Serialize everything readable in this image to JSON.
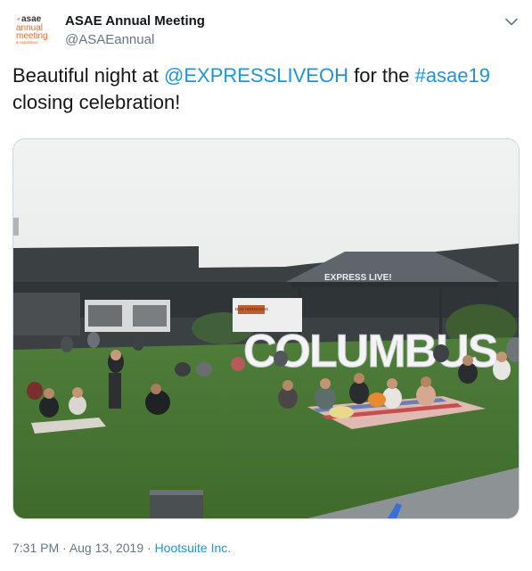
{
  "tweet": {
    "author": {
      "display_name": "ASAE Annual Meeting",
      "handle": "@ASAEannual",
      "avatar_logo": {
        "brand": "asae",
        "line1": "annual",
        "line2": "meeting",
        "line3": "& exposition"
      }
    },
    "text": {
      "part1": "Beautiful night at ",
      "mention": "@EXPRESSLIVEOH",
      "part2": " for the ",
      "hashtag": "#asae19",
      "part3": " closing celebration!"
    },
    "media": {
      "signage": {
        "venue_sign": "EXPRESS LIVE!",
        "letters_sign": "COLUMBUS",
        "banner_sign": "DOS HERMANOS"
      }
    },
    "footer": {
      "time": "7:31 PM",
      "separator": " · ",
      "date": "Aug 13, 2019",
      "source": "Hootsuite Inc."
    },
    "icons": {
      "menu": "chevron-down-icon",
      "avatar": "asae-logo"
    },
    "colors": {
      "link": "#1b95e0",
      "secondary_text": "#657786",
      "brand_orange": "#f26522"
    }
  }
}
